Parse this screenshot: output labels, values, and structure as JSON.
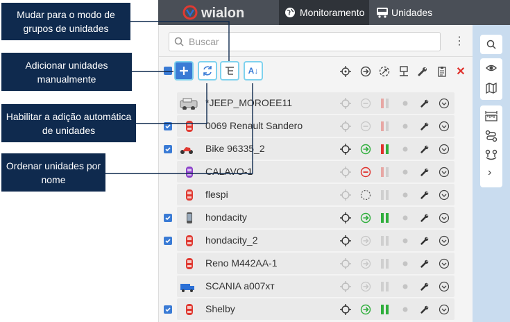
{
  "header": {
    "logo_text": "wialon",
    "tabs": [
      {
        "label": "Monitoramento",
        "icon": "globe-icon",
        "active": true
      },
      {
        "label": "Unidades",
        "icon": "bus-icon",
        "active": false
      }
    ]
  },
  "search": {
    "placeholder": "Buscar"
  },
  "toolbar": {
    "add_icon": "plus-icon",
    "auto_icon": "refresh-icon",
    "groups_icon": "group-mode-icon",
    "sort_icon": "sort-az-icon",
    "sort_label": "A↓"
  },
  "units": [
    {
      "name": "*JEEP_MOROEE11",
      "checked": false,
      "icon": "jeep",
      "active": false
    },
    {
      "name": "0069 Renault Sandero",
      "checked": true,
      "icon": "car-red",
      "active": false
    },
    {
      "name": "Bike 96335_2",
      "checked": true,
      "icon": "bike",
      "active": true,
      "status": "moving"
    },
    {
      "name": "CALAVO-1",
      "checked": false,
      "icon": "car-purple",
      "active": false,
      "status": "stopped"
    },
    {
      "name": "flespi",
      "checked": false,
      "icon": "car-red",
      "active": false,
      "status": "unknown"
    },
    {
      "name": "hondacity",
      "checked": true,
      "icon": "phone",
      "active": true,
      "status": "moving"
    },
    {
      "name": "hondacity_2",
      "checked": true,
      "icon": "car-red",
      "active": true,
      "status": "none"
    },
    {
      "name": "Reno M442AA-1",
      "checked": false,
      "icon": "car-red",
      "active": false,
      "status": "none"
    },
    {
      "name": "SCANIA а007хт",
      "checked": false,
      "icon": "truck",
      "active": false,
      "status": "none"
    },
    {
      "name": "Shelby",
      "checked": true,
      "icon": "car-red",
      "active": true,
      "status": "moving"
    }
  ],
  "callouts": {
    "groups": "Mudar para o modo de grupos de unidades",
    "add": "Adicionar unidades manualmente",
    "auto": "Habilitar a adição automática de unidades",
    "sort": "Ordenar unidades por nome"
  },
  "colors": {
    "header_bg": "#4a4f57",
    "callout_bg": "#0f2a4e",
    "accent_blue": "#3a7bd5",
    "highlight": "#7fd2ee",
    "green": "#2fae3c",
    "red": "#e0302b",
    "sidebar_bg": "#c9dcef"
  }
}
